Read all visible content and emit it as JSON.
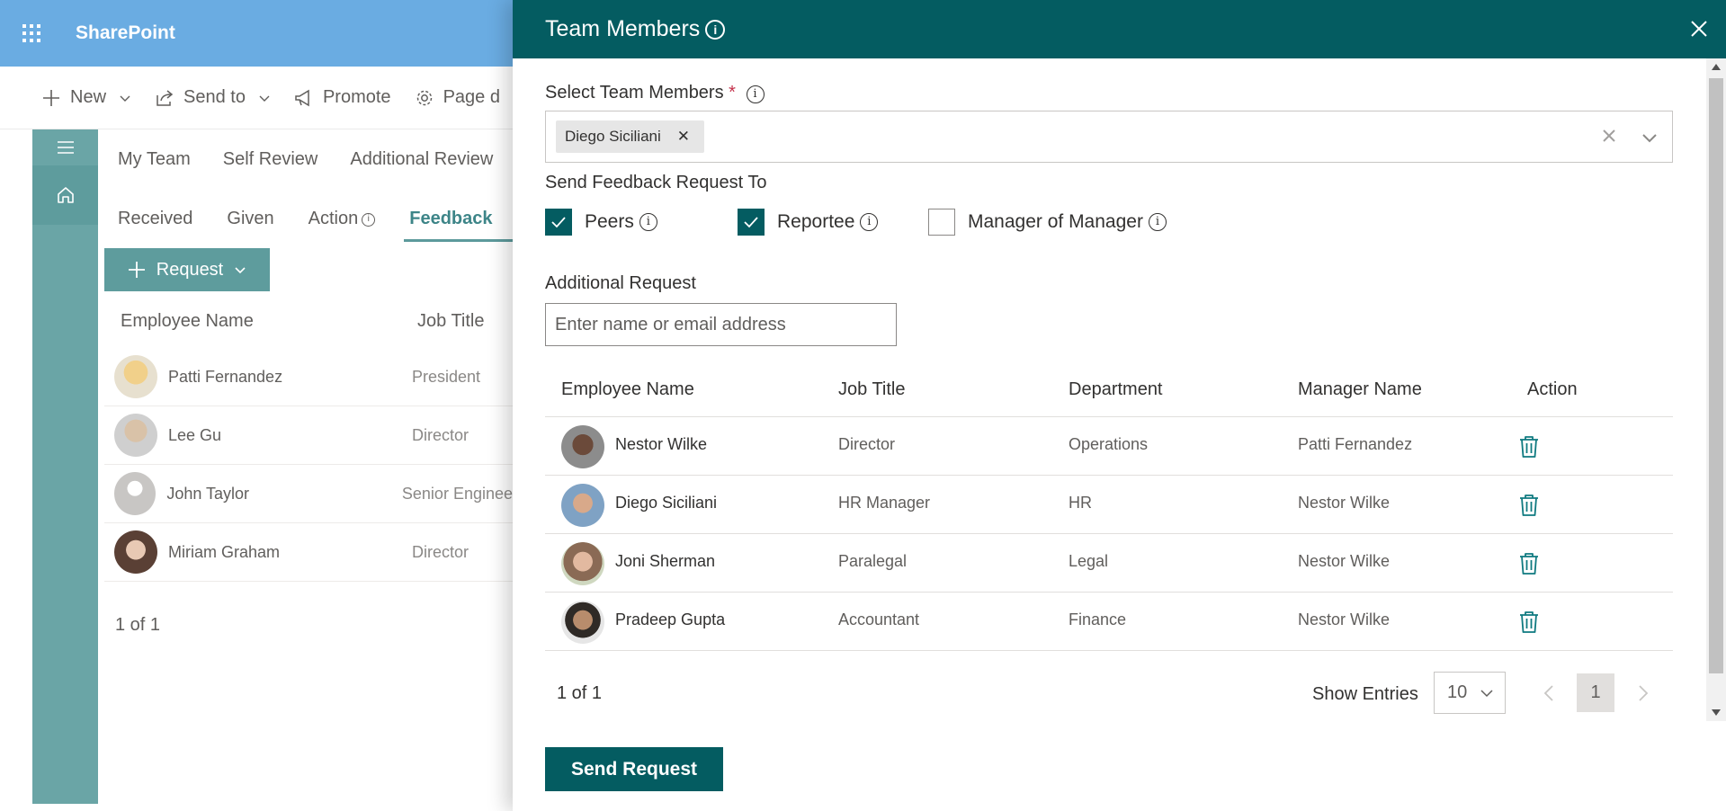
{
  "app": {
    "title": "SharePoint"
  },
  "commandbar": {
    "new_label": "New",
    "sendto_label": "Send to",
    "promote_label": "Promote",
    "page_label": "Page d"
  },
  "bg": {
    "tabs_top": [
      "My Team",
      "Self Review",
      "Additional Review"
    ],
    "tabs_sub": [
      "Received",
      "Given",
      "Action",
      "Feedback"
    ],
    "request_label": "Request",
    "col_name": "Employee Name",
    "col_title": "Job Title",
    "rows": [
      {
        "name": "Patti Fernandez",
        "title": "President"
      },
      {
        "name": "Lee Gu",
        "title": "Director"
      },
      {
        "name": "John Taylor",
        "title": "Senior Engineer"
      },
      {
        "name": "Miriam Graham",
        "title": "Director"
      }
    ],
    "pager": "1 of 1"
  },
  "panel": {
    "title": "Team Members",
    "select_label": "Select Team Members",
    "required_mark": "*",
    "selected_chip": "Diego Siciliani",
    "send_to_label": "Send Feedback Request To",
    "options": [
      {
        "label": "Peers",
        "checked": true
      },
      {
        "label": "Reportee",
        "checked": true
      },
      {
        "label": "Manager of Manager",
        "checked": false
      }
    ],
    "additional_label": "Additional Request",
    "additional_placeholder": "Enter name or email address",
    "table": {
      "headers": [
        "Employee Name",
        "Job Title",
        "Department",
        "Manager Name",
        "Action"
      ],
      "rows": [
        {
          "name": "Nestor Wilke",
          "title": "Director",
          "department": "Operations",
          "manager": "Patti Fernandez"
        },
        {
          "name": "Diego Siciliani",
          "title": "HR Manager",
          "department": "HR",
          "manager": "Nestor Wilke"
        },
        {
          "name": "Joni Sherman",
          "title": "Paralegal",
          "department": "Legal",
          "manager": "Nestor Wilke"
        },
        {
          "name": "Pradeep Gupta",
          "title": "Accountant",
          "department": "Finance",
          "manager": "Nestor Wilke"
        }
      ]
    },
    "pager_text": "1 of 1",
    "show_entries_label": "Show Entries",
    "entries_value": "10",
    "current_page": "1",
    "send_button": "Send Request"
  },
  "colors": {
    "header_bg": "#6aace2",
    "panel_header": "#045c61",
    "accent": "#5e9c9d",
    "trash": "#0f7a80"
  }
}
